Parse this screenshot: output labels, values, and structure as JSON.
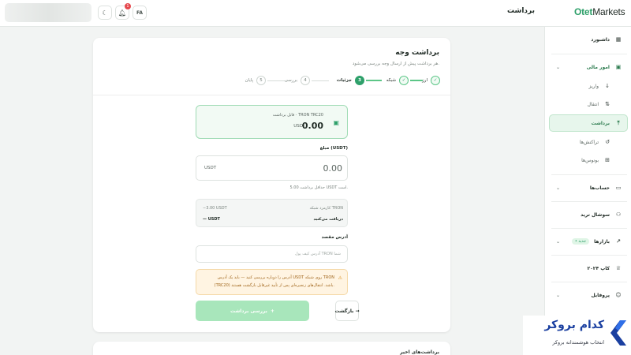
{
  "header": {
    "lang": "FA",
    "notif_count": "1",
    "page_title": "برداشت",
    "logo_main": "Otet",
    "logo_suffix": "Markets"
  },
  "sidebar": {
    "items": [
      {
        "label": "داشبورد"
      },
      {
        "label": "امور مالی"
      },
      {
        "label": "واریز"
      },
      {
        "label": "انتقال"
      },
      {
        "label": "برداشت"
      },
      {
        "label": "تراکنش‌ها"
      },
      {
        "label": "بونوس‌ها"
      },
      {
        "label": "حساب‌ها"
      },
      {
        "label": "سوشال ترید"
      },
      {
        "label": "بازارها"
      },
      {
        "label": "کاپ ۲۰۲۴"
      },
      {
        "label": "پروفایل"
      }
    ],
    "badge_new": "• جدید"
  },
  "card": {
    "title": "برداشت وجه",
    "subtitle": "هر برداشت پیش از ارسال وجه بررسی می‌شود.",
    "steps": [
      {
        "num": "✓",
        "label": "ارز"
      },
      {
        "num": "✓",
        "label": "شبکه"
      },
      {
        "num": "3",
        "label": "جزئیات"
      },
      {
        "num": "4",
        "label": "بررسی"
      },
      {
        "num": "5",
        "label": "پایان"
      }
    ],
    "balance_label": "قابل برداشت · TRON TRC20",
    "balance_value": "0.00",
    "balance_unit": "USD",
    "amount_label": "مبلغ (USDT)",
    "amount_unit": "USDT",
    "amount_value": "0.00",
    "min_hint": "حداقل برداشت 5.00 USDT است.",
    "fee_label": "کارمزد شبکه TRON",
    "fee_value": "−3.00 USDT",
    "receive_label": "دریافت می‌کنید",
    "receive_value": "— USDT",
    "address_label": "آدرس مقصد",
    "address_placeholder": "آدرس کیف پول TRON شما",
    "warning_line1": "آدرس را دوباره بررسی کنید — باید یک آدرس USDT روی شبکه TRON",
    "warning_line2": "(TRC20) باشد. انتقال‌های زنجیره‌ای پس از تأیید غیرقابل بازگشت هستند.",
    "submit_label": "بررسی برداشت",
    "back_label": "بازگشت"
  },
  "card2": {
    "title": "برداشت‌های اخیر"
  },
  "watermark": {
    "line1": "کدام بروکر",
    "line2": "انتخاب هوشمندانه بروکر"
  },
  "colors": {
    "accent": "#2ea06a",
    "warning_bg": "#fff4e2"
  }
}
